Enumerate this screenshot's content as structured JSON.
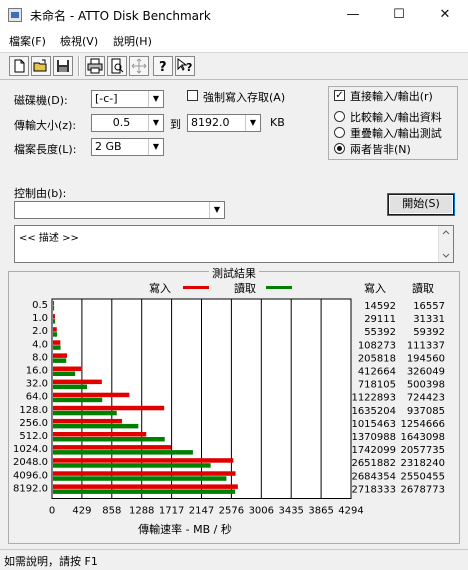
{
  "window": {
    "title": "未命名 - ATTO Disk Benchmark",
    "minimize": "—",
    "maximize": "☐",
    "close": "✕"
  },
  "menu": {
    "items": [
      "檔案(F)",
      "檢視(V)",
      "說明(H)"
    ]
  },
  "toolbar": {
    "icons": [
      "new-icon",
      "open-icon",
      "save-icon",
      "print-icon",
      "print-preview-icon",
      "move-icon",
      "help-icon",
      "context-help-icon"
    ]
  },
  "form": {
    "drive_label": "磁碟機(D):",
    "drive_value": "[-c-]",
    "transfer_label": "傳輸大小(z):",
    "transfer_from": "0.5",
    "transfer_to_label": "到",
    "transfer_to": "8192.0",
    "transfer_unit": "KB",
    "filesize_label": "檔案長度(L):",
    "filesize_value": "2 GB",
    "force_write_label": "強制寫入存取(A)",
    "force_write_checked": false,
    "direct_io_label": "直接輸入/輸出(r)",
    "direct_io_checked": true,
    "radio_compare": "比較輸入/輸出資料",
    "radio_overlap": "重疊輸入/輸出測試",
    "radio_neither": "兩者皆非(N)",
    "selected_radio": "neither",
    "control_label": "控制由(b):",
    "control_value": "",
    "start_button": "開始(S)",
    "description": "<< 描述 >>"
  },
  "results": {
    "title": "測試結果",
    "legend_write": "寫入",
    "legend_read": "讀取",
    "col_write": "寫入",
    "col_read": "讀取"
  },
  "chart_data": {
    "type": "bar",
    "orientation": "horizontal",
    "categories": [
      "0.5",
      "1.0",
      "2.0",
      "4.0",
      "8.0",
      "16.0",
      "32.0",
      "64.0",
      "128.0",
      "256.0",
      "512.0",
      "1024.0",
      "2048.0",
      "4096.0",
      "8192.0"
    ],
    "series": [
      {
        "name": "寫入",
        "color": "#e00000",
        "values": [
          14592,
          29111,
          55392,
          108273,
          205818,
          412664,
          718105,
          1122893,
          1635204,
          1015463,
          1370988,
          1742099,
          2651882,
          2684354,
          2718333
        ]
      },
      {
        "name": "讀取",
        "color": "#008000",
        "values": [
          16557,
          31331,
          59392,
          111337,
          194560,
          326049,
          500398,
          724423,
          937085,
          1254666,
          1643098,
          2057735,
          2318240,
          2550455,
          2678773
        ]
      }
    ],
    "xticks": [
      "0",
      "429",
      "858",
      "1288",
      "1717",
      "2147",
      "2576",
      "3006",
      "3435",
      "3865",
      "4294"
    ],
    "xmax": 4294,
    "xlabel": "傳輸速率 - MB / 秒",
    "grid": true,
    "legend": "top"
  },
  "status": {
    "text": "如需說明，請按 F1"
  }
}
